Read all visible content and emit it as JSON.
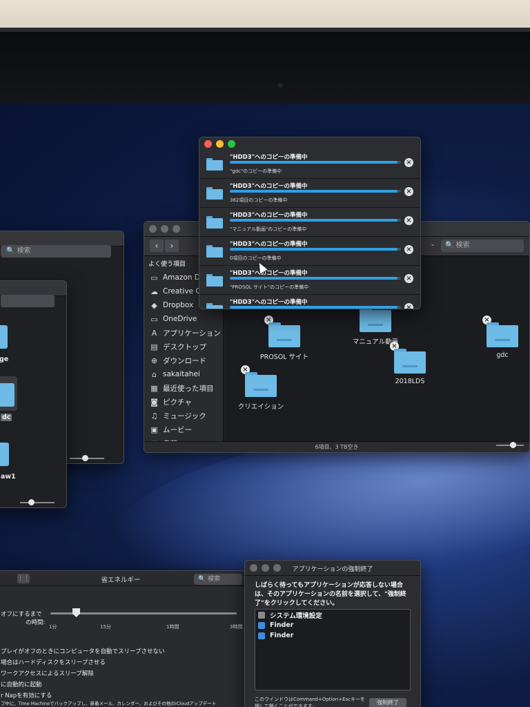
{
  "copy_window": {
    "rows": [
      {
        "title": "\"HDD3\"へのコピーの準備中",
        "subtitle": "\"gdc\"のコピーの準備中",
        "progress": 0.98
      },
      {
        "title": "\"HDD3\"へのコピーの準備中",
        "subtitle": "382項目のコピーの準備中",
        "progress": 0.98
      },
      {
        "title": "\"HDD3\"へのコピーの準備中",
        "subtitle": "\"マニュアル動画\"のコピーの準備中",
        "progress": 0.98
      },
      {
        "title": "\"HDD3\"へのコピーの準備中",
        "subtitle": "0項目のコピーの準備中",
        "progress": 0.98
      },
      {
        "title": "\"HDD3\"へのコピーの準備中",
        "subtitle": "\"PROSOL サイト\"のコピーの準備中",
        "progress": 0.98
      },
      {
        "title": "\"HDD3\"へのコピーの準備中",
        "subtitle": "",
        "progress": 0.98
      }
    ],
    "accent": "#2ea0e8"
  },
  "finder": {
    "search_placeholder": "検索",
    "sidebar_heading": "よく使う項目",
    "sidebar_items": [
      {
        "label": "Amazon Drive",
        "icon": "folder-icon"
      },
      {
        "label": "Creative Cloud",
        "icon": "creative-cloud-icon"
      },
      {
        "label": "Dropbox",
        "icon": "dropbox-icon"
      },
      {
        "label": "OneDrive",
        "icon": "folder-icon"
      },
      {
        "label": "アプリケーション",
        "icon": "applications-icon"
      },
      {
        "label": "デスクトップ",
        "icon": "desktop-icon"
      },
      {
        "label": "ダウンロード",
        "icon": "download-icon"
      },
      {
        "label": "sakaitahei",
        "icon": "home-icon"
      },
      {
        "label": "最近使った項目",
        "icon": "recents-icon"
      },
      {
        "label": "ピクチャ",
        "icon": "camera-icon"
      },
      {
        "label": "ミュージック",
        "icon": "music-icon"
      },
      {
        "label": "ムービー",
        "icon": "movie-icon"
      },
      {
        "label": "書類",
        "icon": "document-icon"
      }
    ],
    "folders": [
      {
        "name": "マニュアル動画"
      },
      {
        "name": "PROSOL サイト"
      },
      {
        "name": "2018LDS"
      },
      {
        "name": "gdc"
      },
      {
        "name": "クリエイション"
      }
    ],
    "status": "6項目、3 TB空き"
  },
  "left_window1": {
    "search_placeholder": "検索"
  },
  "left_window2": {
    "labels": [
      "ge",
      "dc",
      "aw1"
    ]
  },
  "energy_saver": {
    "title": "省エネルギー",
    "search_placeholder": "検索",
    "slider_label_line1": "オフにするまで",
    "slider_label_line2": "の時間:",
    "ticks": [
      "1分",
      "15分",
      "1時間",
      "3時間"
    ],
    "options": [
      "プレイがオフのときにコンピュータを自動でスリープさせない",
      "場合はハードディスクをスリープさせる",
      "ワークアクセスによるスリープ解除",
      "に自動的に起動",
      "r Napを有効にする",
      "プ中に、Time Machineでバックアップし、新着メール、カレンダー、およびその他のiCloudアップデート"
    ]
  },
  "force_quit": {
    "title": "アプリケーションの強制終了",
    "message": "しばらく待ってもアプリケーションが応答しない場合は、そのアプリケーションの名前を選択して、\"強制終了\"をクリックしてください。",
    "apps": [
      {
        "name": "システム環境設定",
        "icon": "system-preferences-icon"
      },
      {
        "name": "Finder",
        "icon": "finder-icon"
      },
      {
        "name": "Finder",
        "icon": "finder-icon"
      }
    ],
    "footer": "このウインドウはCommand+Option+Escキーを押して開くことができます。",
    "button": "強制終了"
  }
}
